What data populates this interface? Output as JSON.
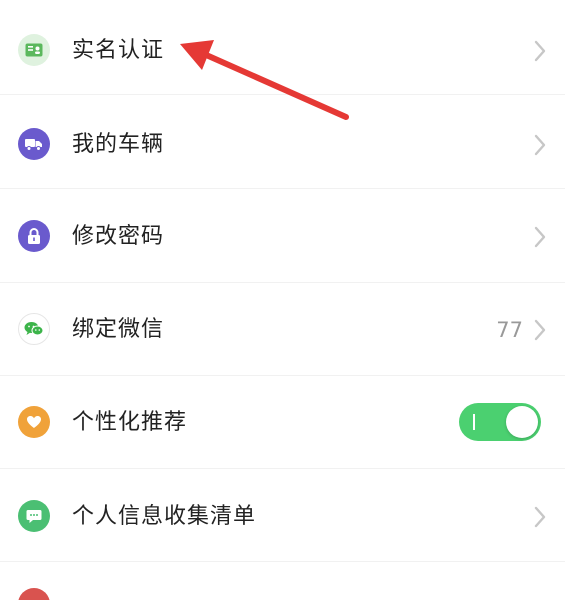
{
  "settings": {
    "items": [
      {
        "label": "实名认证",
        "value": "",
        "type": "link",
        "icon": "id-card-icon",
        "icon_bg": "#dff2df",
        "icon_fg": "#5bb85d"
      },
      {
        "label": "我的车辆",
        "value": "",
        "type": "link",
        "icon": "truck-icon",
        "icon_bg": "#6a5acd",
        "icon_fg": "#ffffff"
      },
      {
        "label": "修改密码",
        "value": "",
        "type": "link",
        "icon": "lock-icon",
        "icon_bg": "#6a5acd",
        "icon_fg": "#ffffff"
      },
      {
        "label": "绑定微信",
        "value": "77",
        "type": "link",
        "icon": "wechat-icon",
        "icon_bg": "#ffffff",
        "icon_fg": "#3cb44a"
      },
      {
        "label": "个性化推荐",
        "value": "",
        "type": "toggle",
        "toggle_on": true,
        "icon": "heart-icon",
        "icon_bg": "#f0a23a",
        "icon_fg": "#ffffff"
      },
      {
        "label": "个人信息收集清单",
        "value": "",
        "type": "link",
        "icon": "chat-icon",
        "icon_bg": "#4bbf73",
        "icon_fg": "#ffffff"
      }
    ]
  },
  "colors": {
    "toggle_on": "#4bd070",
    "annotation_arrow": "#e53935",
    "chevron": "#c7c7c7"
  }
}
